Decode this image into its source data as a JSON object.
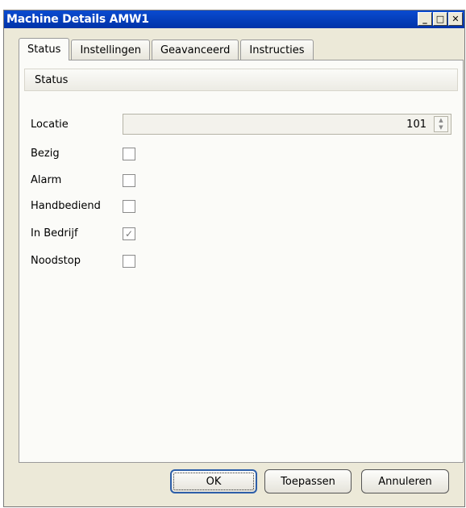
{
  "window": {
    "title": "Machine Details AMW1",
    "controls": {
      "minimize": "_",
      "maximize": "□",
      "close": "✕"
    }
  },
  "tabs": [
    {
      "label": "Status",
      "active": true
    },
    {
      "label": "Instellingen",
      "active": false
    },
    {
      "label": "Geavanceerd",
      "active": false
    },
    {
      "label": "Instructies",
      "active": false
    }
  ],
  "panel": {
    "group_title": "Status",
    "location": {
      "label": "Locatie",
      "value": "101"
    },
    "checkboxes": [
      {
        "label": "Bezig",
        "checked": false
      },
      {
        "label": "Alarm",
        "checked": false
      },
      {
        "label": "Handbediend",
        "checked": false
      },
      {
        "label": "In Bedrijf",
        "checked": true
      },
      {
        "label": "Noodstop",
        "checked": false
      }
    ]
  },
  "buttons": {
    "ok": "OK",
    "apply": "Toepassen",
    "cancel": "Annuleren"
  },
  "colors": {
    "titlebar": "#0a4bd0",
    "dialog_bg": "#ece9d8"
  }
}
